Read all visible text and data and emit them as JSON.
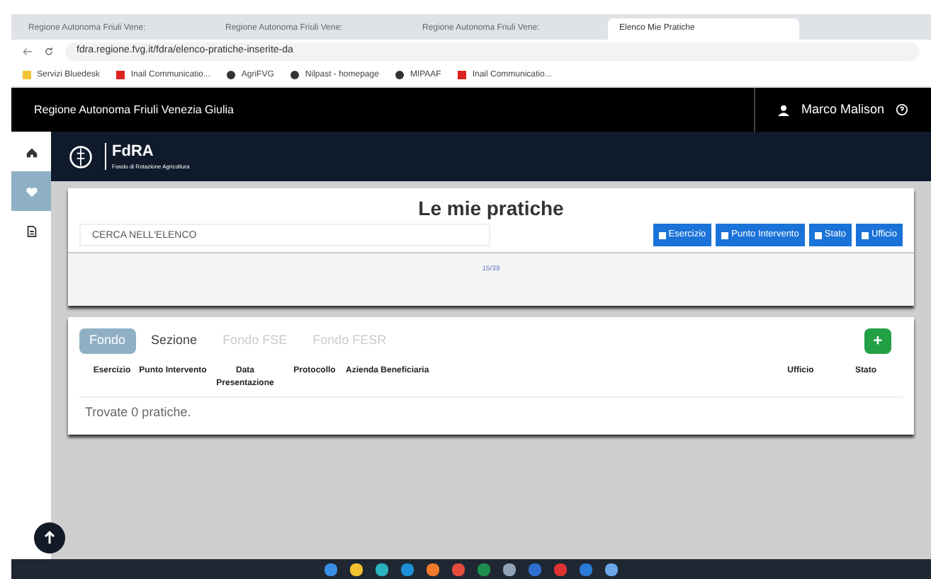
{
  "browser": {
    "tabs": [
      {
        "title": "Regione Autonoma Friuli Vene:",
        "selected": false
      },
      {
        "title": "Regione Autonoma Friuli Vene:",
        "selected": false
      },
      {
        "title": "Regione Autonoma Friuli Vene:",
        "selected": false
      },
      {
        "title": "Elenco Mie Pratiche",
        "selected": true
      }
    ],
    "url": "fdra.regione.fvg.it/fdra/elenco-pratiche-inserite-da",
    "bookmarks": [
      {
        "label": "Servizi Bluedesk",
        "kind": "folder"
      },
      {
        "label": "Inail Communicatio...",
        "kind": "red"
      },
      {
        "label": "AgriFVG",
        "kind": "globe"
      },
      {
        "label": "Nilpast - homepage",
        "kind": "globe"
      },
      {
        "label": "MIPAAF",
        "kind": "globe"
      },
      {
        "label": "Inail Communicatio...",
        "kind": "red"
      }
    ]
  },
  "top_bar": {
    "title": "Regione Autonoma Friuli Venezia Giulia",
    "user": "Marco Malison"
  },
  "brand": {
    "name": "FdRA",
    "subtitle": "Fondo di Rotazione Agricoltura"
  },
  "sidebar": {
    "items": [
      {
        "kind": "home",
        "selected": false
      },
      {
        "kind": "favorites",
        "selected": true
      },
      {
        "kind": "document",
        "selected": false
      }
    ]
  },
  "search_card": {
    "title": "Le mie pratiche",
    "placeholder": "CERCA NELL'ELENCO",
    "filters": [
      "Esercizio",
      "Punto Intervento",
      "Stato",
      "Ufficio"
    ],
    "footer": "15/39"
  },
  "list_card": {
    "tabs": [
      {
        "label": "Fondo",
        "selected": true,
        "disabled": false
      },
      {
        "label": "Sezione",
        "selected": false,
        "disabled": false
      },
      {
        "label": "Fondo FSE",
        "selected": false,
        "disabled": true
      },
      {
        "label": "Fondo FESR",
        "selected": false,
        "disabled": true
      }
    ],
    "add_button": "+",
    "columns": [
      "Esercizio",
      "Punto Intervento",
      "Data Presentazione",
      "Protocollo",
      "Azienda Beneficiaria",
      "Ufficio",
      "Stato"
    ],
    "empty_message": "Trovate 0 pratiche."
  }
}
